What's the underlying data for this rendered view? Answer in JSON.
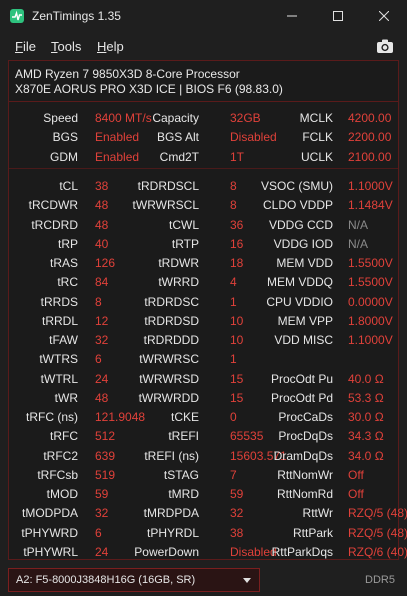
{
  "window": {
    "title": "ZenTimings 1.35",
    "minimize_glyph": "—",
    "maximize_glyph": "☐",
    "close_glyph": "✕"
  },
  "menu": {
    "file": {
      "accel": "F",
      "rest": "ile"
    },
    "tools": {
      "accel": "T",
      "rest": "ools"
    },
    "help": {
      "accel": "H",
      "rest": "elp"
    },
    "screenshot_icon": "camera-icon"
  },
  "system": {
    "cpu": "AMD Ryzen 7 9850X3D 8-Core Processor",
    "board": "X870E AORUS PRO X3D ICE | BIOS F6 (98.83.0)"
  },
  "summary": [
    [
      {
        "label": "Speed",
        "value": "8400 MT/s"
      },
      {
        "label": "Capacity",
        "value": "32GB"
      },
      {
        "label": "MCLK",
        "value": "4200.00"
      }
    ],
    [
      {
        "label": "BGS",
        "value": "Enabled"
      },
      {
        "label": "BGS Alt",
        "value": "Disabled"
      },
      {
        "label": "FCLK",
        "value": "2200.00"
      }
    ],
    [
      {
        "label": "GDM",
        "value": "Enabled"
      },
      {
        "label": "Cmd2T",
        "value": "1T"
      },
      {
        "label": "UCLK",
        "value": "2100.00"
      }
    ]
  ],
  "timings": [
    [
      {
        "label": "tCL",
        "value": "38"
      },
      {
        "label": "tRDRDSCL",
        "value": "8"
      },
      {
        "label": "VSOC (SMU)",
        "value": "1.1000V"
      }
    ],
    [
      {
        "label": "tRCDWR",
        "value": "48"
      },
      {
        "label": "tWRWRSCL",
        "value": "8"
      },
      {
        "label": "CLDO VDDP",
        "value": "1.1484V"
      }
    ],
    [
      {
        "label": "tRCDRD",
        "value": "48"
      },
      {
        "label": "tCWL",
        "value": "36"
      },
      {
        "label": "VDDG CCD",
        "value": "N/A",
        "muted": true
      }
    ],
    [
      {
        "label": "tRP",
        "value": "40"
      },
      {
        "label": "tRTP",
        "value": "16"
      },
      {
        "label": "VDDG IOD",
        "value": "N/A",
        "muted": true
      }
    ],
    [
      {
        "label": "tRAS",
        "value": "126"
      },
      {
        "label": "tRDWR",
        "value": "18"
      },
      {
        "label": "MEM VDD",
        "value": "1.5500V"
      }
    ],
    [
      {
        "label": "tRC",
        "value": "84"
      },
      {
        "label": "tWRRD",
        "value": "4"
      },
      {
        "label": "MEM VDDQ",
        "value": "1.5500V"
      }
    ],
    [
      {
        "label": "tRRDS",
        "value": "8"
      },
      {
        "label": "tRDRDSC",
        "value": "1"
      },
      {
        "label": "CPU VDDIO",
        "value": "0.0000V"
      }
    ],
    [
      {
        "label": "tRRDL",
        "value": "12"
      },
      {
        "label": "tRDRDSD",
        "value": "10"
      },
      {
        "label": "MEM VPP",
        "value": "1.8000V"
      }
    ],
    [
      {
        "label": "tFAW",
        "value": "32"
      },
      {
        "label": "tRDRDDD",
        "value": "10"
      },
      {
        "label": "VDD MISC",
        "value": "1.1000V"
      }
    ],
    [
      {
        "label": "tWTRS",
        "value": "6"
      },
      {
        "label": "tWRWRSC",
        "value": "1"
      },
      {
        "label": "",
        "value": ""
      }
    ],
    [
      {
        "label": "tWTRL",
        "value": "24"
      },
      {
        "label": "tWRWRSD",
        "value": "15"
      },
      {
        "label": "ProcOdt Pu",
        "value": "40.0 Ω"
      }
    ],
    [
      {
        "label": "tWR",
        "value": "48"
      },
      {
        "label": "tWRWRDD",
        "value": "15"
      },
      {
        "label": "ProcOdt Pd",
        "value": "53.3 Ω"
      }
    ],
    [
      {
        "label": "tRFC (ns)",
        "value": "121.9048"
      },
      {
        "label": "tCKE",
        "value": "0"
      },
      {
        "label": "ProcCaDs",
        "value": "30.0 Ω"
      }
    ],
    [
      {
        "label": "tRFC",
        "value": "512"
      },
      {
        "label": "tREFI",
        "value": "65535"
      },
      {
        "label": "ProcDqDs",
        "value": "34.3 Ω"
      }
    ],
    [
      {
        "label": "tRFC2",
        "value": "639"
      },
      {
        "label": "tREFI (ns)",
        "value": "15603.571"
      },
      {
        "label": "DramDqDs",
        "value": "34.0 Ω"
      }
    ],
    [
      {
        "label": "tRFCsb",
        "value": "519"
      },
      {
        "label": "tSTAG",
        "value": "7"
      },
      {
        "label": "RttNomWr",
        "value": "Off"
      }
    ],
    [
      {
        "label": "tMOD",
        "value": "59"
      },
      {
        "label": "tMRD",
        "value": "59"
      },
      {
        "label": "RttNomRd",
        "value": "Off"
      }
    ],
    [
      {
        "label": "tMODPDA",
        "value": "32"
      },
      {
        "label": "tMRDPDA",
        "value": "32"
      },
      {
        "label": "RttWr",
        "value": "RZQ/5 (48)"
      }
    ],
    [
      {
        "label": "tPHYWRD",
        "value": "6"
      },
      {
        "label": "tPHYRDL",
        "value": "38"
      },
      {
        "label": "RttPark",
        "value": "RZQ/5 (48)"
      }
    ],
    [
      {
        "label": "tPHYWRL",
        "value": "24"
      },
      {
        "label": "PowerDown",
        "value": "Disabled"
      },
      {
        "label": "RttParkDqs",
        "value": "RZQ/6 (40)"
      }
    ]
  ],
  "footer": {
    "dimm_selected": "A2: F5-8000J3848H16G (16GB, SR)",
    "memory_type": "DDR5"
  },
  "colors": {
    "accent": "#e0413a",
    "background": "#1f1f1f",
    "border": "#5a1b1b",
    "icon_green": "#2ec27e"
  }
}
